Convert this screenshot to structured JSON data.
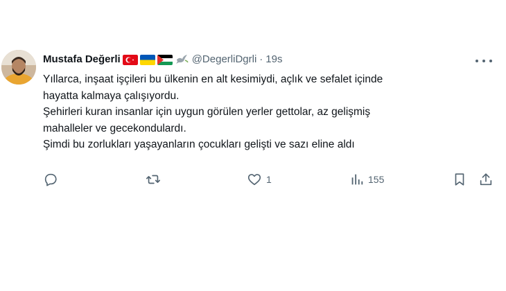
{
  "author": {
    "display_name": "Mustafa Değerli",
    "handle": "@DegerliDgrli",
    "separator": "·",
    "time": "19s",
    "badges": [
      "turkey-flag-icon",
      "ukraine-flag-icon",
      "palestine-flag-icon",
      "dove-icon"
    ]
  },
  "tweet": {
    "lines": [
      "Yıllarca, inşaat işçileri bu ülkenin en alt kesimiydi, açlık ve sefalet içinde",
      "hayatta kalmaya çalışıyordu.",
      "Şehirleri kuran insanlar için uygun görülen yerler gettolar, az gelişmiş",
      "mahalleler ve gecekondulardı.",
      "Şimdi bu zorlukları yaşayanların çocukları gelişti ve sazı eline aldı"
    ]
  },
  "actions": {
    "reply_count": "",
    "retweet_count": "",
    "like_count": "1",
    "views_count": "155"
  },
  "colors": {
    "text": "#0f1419",
    "secondary": "#536471",
    "background": "#ffffff"
  }
}
